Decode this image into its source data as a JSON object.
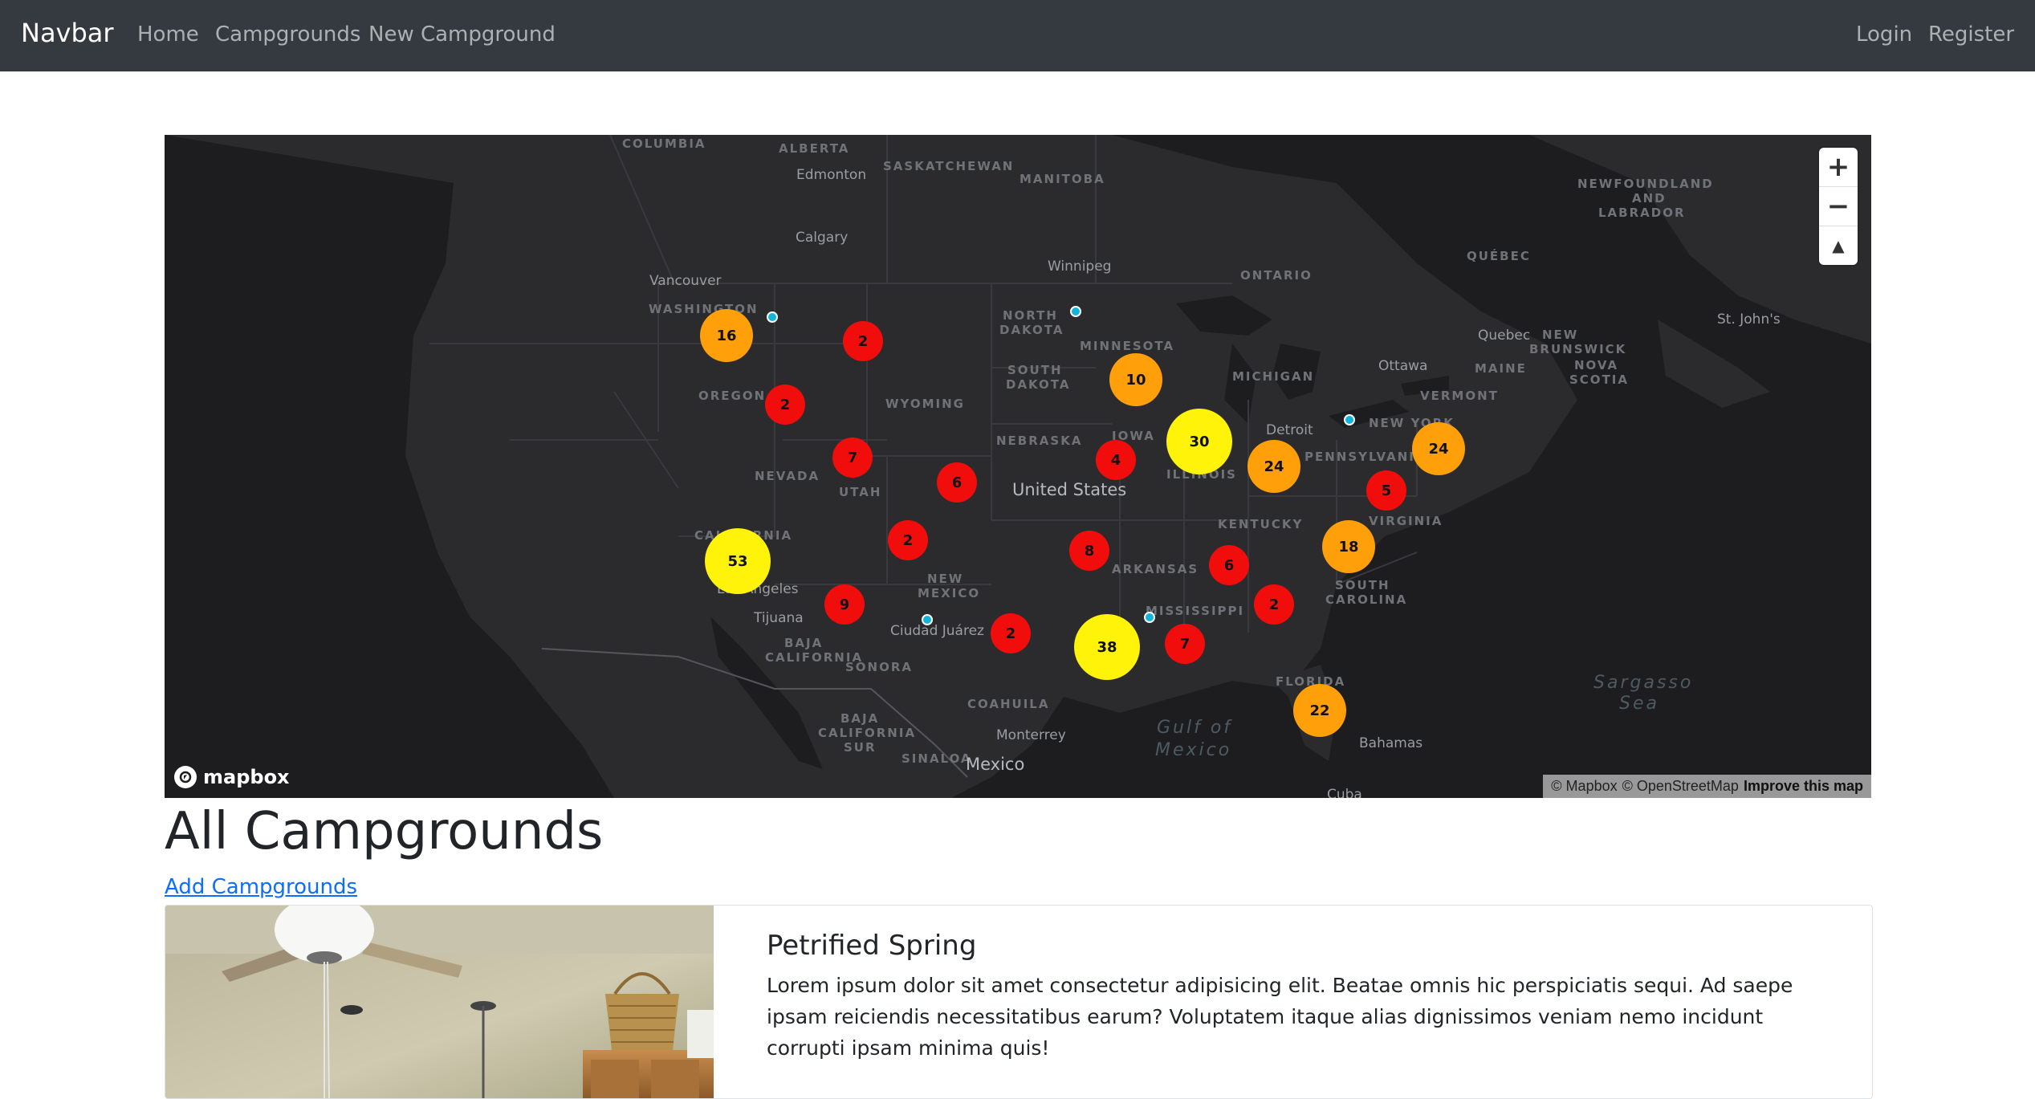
{
  "navbar": {
    "brand": "Navbar",
    "links": [
      "Home",
      "Campgrounds",
      "New Campground"
    ],
    "auth": [
      "Login",
      "Register"
    ]
  },
  "map": {
    "labels": {
      "states": [
        "COLUMBIA",
        "ALBERTA",
        "SASKATCHEWAN",
        "MANITOBA",
        "NEWFOUNDLAND",
        "AND",
        "LABRADOR",
        "QUÉBEC",
        "ONTARIO",
        "WASHINGTON",
        "NORTH",
        "DAKOTA",
        "MINNESOTA",
        "SOUTH",
        "DAKOTA",
        "OREGON",
        "WYOMING",
        "MICHIGAN",
        "NEW YORK",
        "NEW",
        "BRUNSWICK",
        "NOVA",
        "SCOTIA",
        "MAINE",
        "VERMONT",
        "IOWA",
        "NEBRASKA",
        "PENNSYLVANIA",
        "NEVADA",
        "UTAH",
        "ILLINOIS",
        "KENTUCKY",
        "VIRGINIA",
        "CALIFORNIA",
        "NEW",
        "MEXICO",
        "ARKANSAS",
        "SOUTH",
        "CAROLINA",
        "MISSISSIPPI",
        "BAJA",
        "CALIFORNIA",
        "SONORA",
        "FLORIDA",
        "COAHUILA",
        "BAJA",
        "CALIFORNIA",
        "SUR",
        "SINALOA"
      ],
      "cities": [
        "Edmonton",
        "Calgary",
        "Winnipeg",
        "Vancouver",
        "Quebec",
        "St. John's",
        "Ottawa",
        "Detroit",
        "Los Angeles",
        "Tijuana",
        "Ciudad Juárez",
        "Monterrey",
        "Bahamas",
        "Cuba"
      ],
      "countries": [
        "United States",
        "Mexico"
      ],
      "seas": [
        "Sargasso",
        "Sea",
        "Gulf of",
        "Mexico"
      ]
    },
    "clusters": [
      {
        "count": "16",
        "level": "medium"
      },
      {
        "count": "2",
        "level": "small"
      },
      {
        "count": "2",
        "level": "small"
      },
      {
        "count": "10",
        "level": "medium"
      },
      {
        "count": "30",
        "level": "large"
      },
      {
        "count": "24",
        "level": "medium"
      },
      {
        "count": "24",
        "level": "medium"
      },
      {
        "count": "7",
        "level": "small"
      },
      {
        "count": "6",
        "level": "small"
      },
      {
        "count": "4",
        "level": "small"
      },
      {
        "count": "5",
        "level": "small"
      },
      {
        "count": "53",
        "level": "large"
      },
      {
        "count": "2",
        "level": "small"
      },
      {
        "count": "8",
        "level": "small"
      },
      {
        "count": "6",
        "level": "small"
      },
      {
        "count": "18",
        "level": "medium"
      },
      {
        "count": "9",
        "level": "small"
      },
      {
        "count": "2",
        "level": "small"
      },
      {
        "count": "38",
        "level": "large"
      },
      {
        "count": "7",
        "level": "small"
      },
      {
        "count": "2",
        "level": "small"
      },
      {
        "count": "22",
        "level": "medium"
      }
    ],
    "points": 5,
    "controls": {
      "zoom_in": "+",
      "zoom_out": "−",
      "compass": "▲"
    },
    "logo": "mapbox",
    "attribution": {
      "mapbox": "© Mapbox",
      "osm": "© OpenStreetMap",
      "improve": "Improve this map"
    },
    "colors": {
      "small": "#f20d0d",
      "medium": "#ff9f0a",
      "large": "#fff30a",
      "point": "#11b4da"
    }
  },
  "page": {
    "title": "All Campgrounds",
    "add_link": "Add Campgrounds"
  },
  "campground": {
    "title": "Petrified Spring",
    "description": "Lorem ipsum dolor sit amet consectetur adipisicing elit. Beatae omnis hic perspiciatis sequi. Ad saepe ipsam reiciendis necessitatibus earum? Voluptatem itaque alias dignissimos veniam nemo incidunt corrupti ipsam minima quis!"
  }
}
